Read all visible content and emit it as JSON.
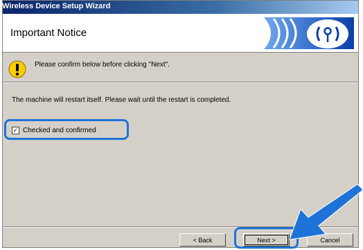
{
  "window": {
    "title": "Wireless Device Setup Wizard"
  },
  "header": {
    "title": "Important Notice",
    "logo_icon": "wireless-waves-logo-icon"
  },
  "notice": {
    "icon": "warning-exclamation-icon",
    "text": "Please confirm below before clicking \"Next\"."
  },
  "body": {
    "message": "The machine will restart itself.  Please wait until the restart is completed."
  },
  "confirm": {
    "label": "Checked and confirmed",
    "checked": true,
    "mark": "✓"
  },
  "buttons": {
    "back": "< Back",
    "next": "Next >",
    "cancel": "Cancel"
  },
  "colors": {
    "highlight": "#1e73d8",
    "arrow": "#1e73d8",
    "dialog_bg": "#d4d0c8",
    "titlebar": "#0a246a"
  }
}
